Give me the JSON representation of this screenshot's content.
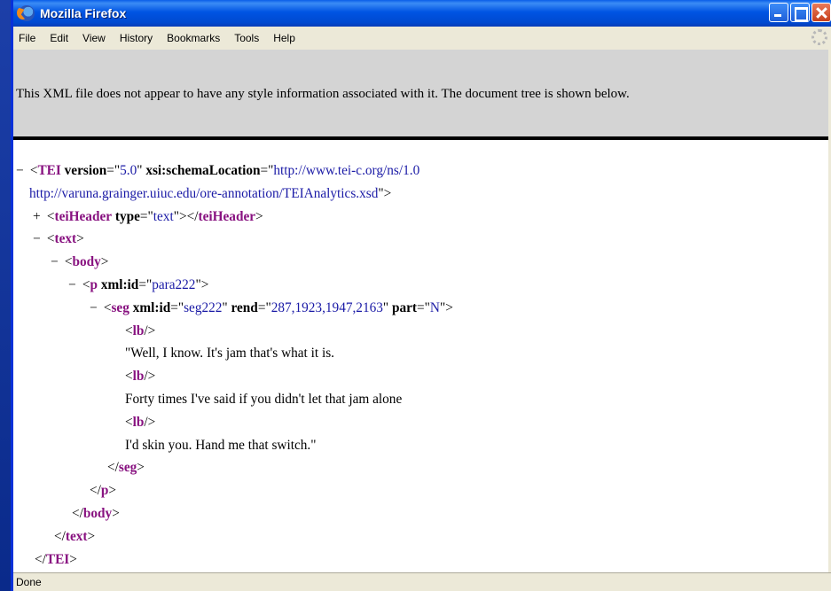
{
  "window": {
    "title": "Mozilla Firefox"
  },
  "menu": [
    "File",
    "Edit",
    "View",
    "History",
    "Bookmarks",
    "Tools",
    "Help"
  ],
  "banner": "This XML file does not appear to have any style information associated with it. The document tree is shown below.",
  "tree": {
    "l1": {
      "toggle": "−",
      "open": "<",
      "tag": "TEI",
      "a1": "version",
      "eq": "=\"",
      "v1": "5.0",
      "q": "\"",
      "a2": "xsi:schemaLocation",
      "v2a": "http://www.tei-c.org/ns/1.0"
    },
    "l2": {
      "v2b": "http://varuna.grainger.uiuc.edu/ore-annotation/TEIAnalytics.xsd",
      "close": "\">"
    },
    "l3": {
      "toggle": "+",
      "open": "<",
      "tag": "teiHeader",
      "a": "type",
      "v": "text",
      "mid": "\"></",
      "ctag": "teiHeader",
      "end": ">"
    },
    "l4": {
      "toggle": "−",
      "open": "<",
      "tag": "text",
      "end": ">"
    },
    "l5": {
      "toggle": "−",
      "open": "<",
      "tag": "body",
      "end": ">"
    },
    "l6": {
      "toggle": "−",
      "open": "<",
      "tag": "p",
      "a": "xml:id",
      "v": "para222",
      "end": "\">"
    },
    "l7": {
      "toggle": "−",
      "open": "<",
      "tag": "seg",
      "a1": "xml:id",
      "v1": "seg222",
      "a2": "rend",
      "v2": "287,1923,1947,2163",
      "a3": "part",
      "v3": "N",
      "end": "\">"
    },
    "lb_tag": "lb",
    "text1": "\"Well, I know. It's jam that's what it is.",
    "text2": "Forty times I've said if you didn't let that jam alone",
    "text3": "I'd skin you. Hand me that switch.\"",
    "close_seg": "seg",
    "close_p": "p",
    "close_body": "body",
    "close_text": "text",
    "close_tei": "TEI"
  },
  "status": "Done"
}
